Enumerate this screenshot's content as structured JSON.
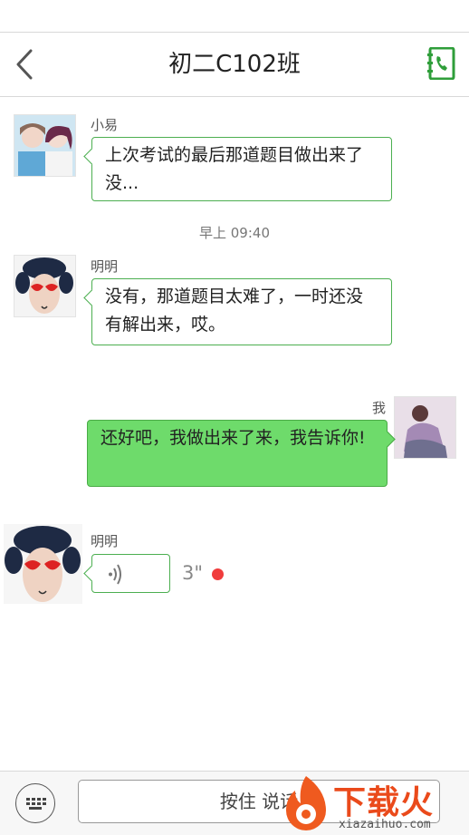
{
  "header": {
    "title": "初二C102班",
    "back_icon": "chevron-left-icon",
    "contact_icon": "contact-book-phone-icon",
    "accent": "#2f9e3a"
  },
  "messages": [
    {
      "sender": "小易",
      "text": "上次考试的最后那道题目做出来了没..."
    },
    {
      "timestamp": "早上 09:40"
    },
    {
      "sender": "明明",
      "text": "没有，那道题目太难了，一时还没有解出来，哎。"
    },
    {
      "sender": "我",
      "text": "还好吧，我做出来了来，我告诉你!"
    },
    {
      "sender": "明明",
      "voice_duration": "3\"",
      "unread": true
    }
  ],
  "bottom_bar": {
    "hold_to_talk": "按住 说话"
  },
  "watermark": {
    "brand": "下载火",
    "domain": "xiazaihuo.com"
  },
  "colors": {
    "bubble_border": "#4caf50",
    "my_bubble": "#6edb6b",
    "unread_dot": "#f03c3c"
  }
}
